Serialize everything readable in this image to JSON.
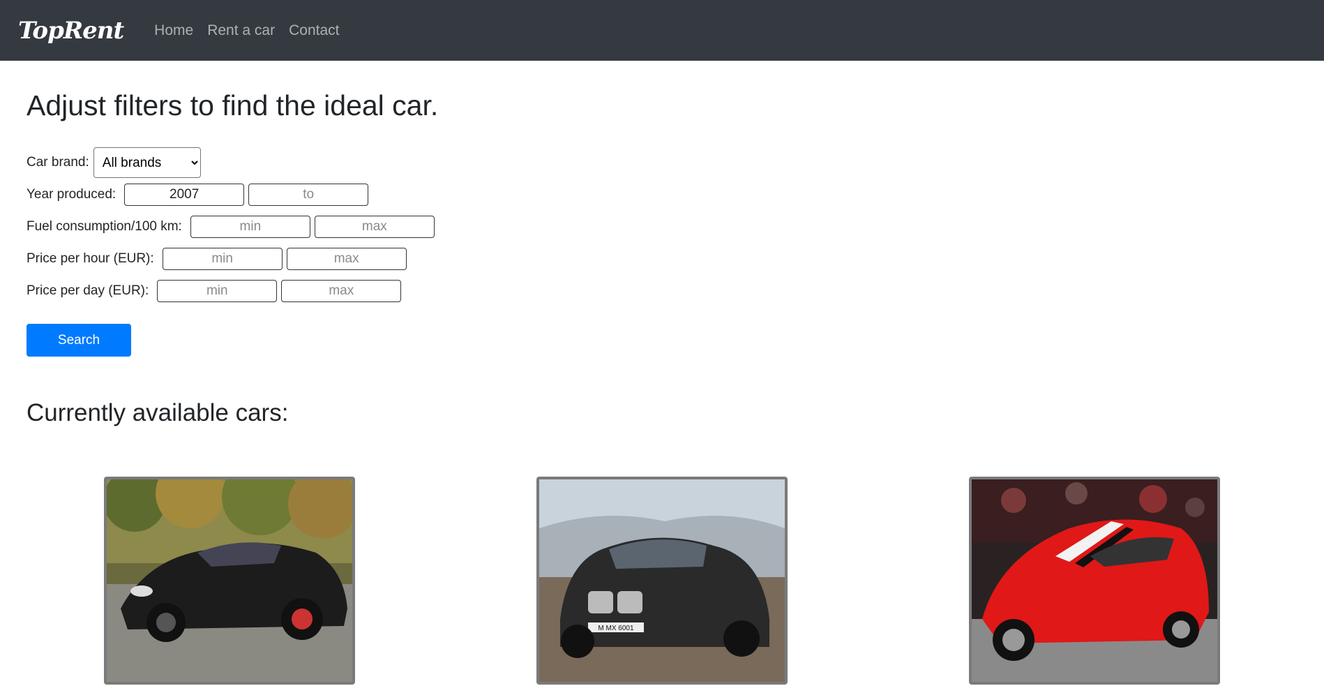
{
  "navbar": {
    "brand": "TopRent",
    "links": [
      "Home",
      "Rent a car",
      "Contact"
    ]
  },
  "main": {
    "title": "Adjust filters to find the ideal car.",
    "filters": {
      "brand_label": "Car brand:",
      "brand_value": "All brands",
      "year_label": "Year produced:",
      "year_from_value": "2007",
      "year_to_placeholder": "to",
      "fuel_label": "Fuel consumption/100 km:",
      "fuel_min_placeholder": "min",
      "fuel_max_placeholder": "max",
      "hour_label": "Price per hour (EUR):",
      "hour_min_placeholder": "min",
      "hour_max_placeholder": "max",
      "day_label": "Price per day (EUR):",
      "day_min_placeholder": "min",
      "day_max_placeholder": "max"
    },
    "search_label": "Search",
    "cars_title": "Currently available cars:",
    "cars": [
      {
        "photo": "black-porsche-panamera",
        "color": "#1c1c1c"
      },
      {
        "photo": "black-bmw-x6",
        "color": "#2a2a2a",
        "plate": "M MX 6001"
      },
      {
        "photo": "red-ferrari-488-pista",
        "color": "#e01818"
      }
    ]
  }
}
